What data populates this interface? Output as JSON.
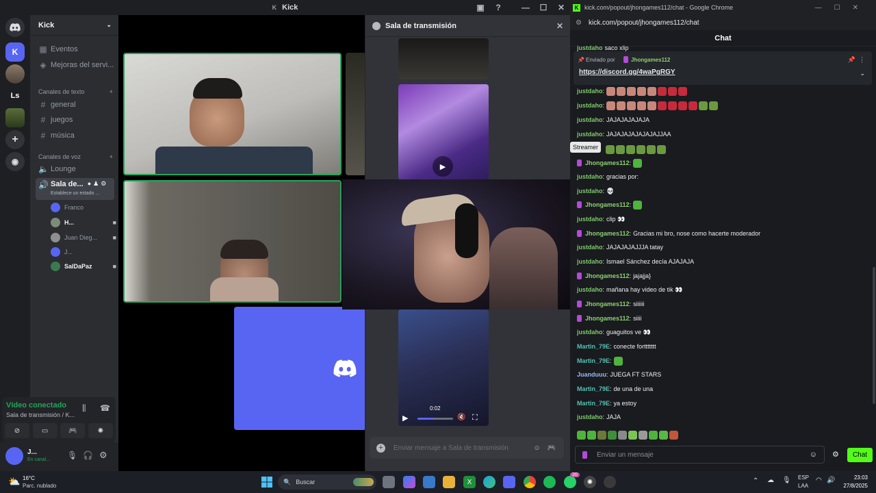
{
  "discord": {
    "window_title": "Kick",
    "server_rail": {
      "letter_server": "Ls"
    },
    "guild_name": "Kick",
    "nav": [
      {
        "label": "Eventos"
      },
      {
        "label": "Mejoras del servi..."
      }
    ],
    "text_category": "Canales de texto",
    "text_channels": [
      "general",
      "juegos",
      "música"
    ],
    "voice_category": "Canales de voz",
    "voice_channels": [
      {
        "label": "Lounge"
      },
      {
        "label": "Sala de...",
        "status": "Establece un estado ..."
      }
    ],
    "voice_users": [
      "Franco",
      "H...",
      "Juan Dieg...",
      "J...",
      "SalDaPaz"
    ],
    "voice_panel": {
      "status": "Vídeo conectado",
      "location": "Sala de transmisión / K..."
    },
    "user_panel": {
      "name": "J...",
      "status": "En canal..."
    },
    "thread": {
      "title": "Sala de transmisión",
      "video_time": "0:02",
      "input_placeholder": "Enviar mensaje a Sala de transmisión"
    }
  },
  "chrome": {
    "window_title": "kick.com/popout/jhongames112/chat - Google Chrome",
    "url": "kick.com/popout/jhongames112/chat",
    "chat_title": "Chat",
    "pinned": {
      "sent_by_label": "Enviado por",
      "sender": "Jhongames112",
      "link": "https://discord.gg/4waPgRGY"
    },
    "tooltip": "Streamer",
    "messages": [
      {
        "user": "justdaho",
        "text": "saco xlip",
        "color": "#7ec86a"
      },
      {
        "user": "justdaho",
        "text": "",
        "color": "#7ec86a",
        "emotes": 8
      },
      {
        "user": "justdaho",
        "text": "",
        "color": "#7ec86a",
        "emotes": 11
      },
      {
        "user": "justdaho",
        "text": "JAJAJAJAJAJA",
        "color": "#7ec86a"
      },
      {
        "user": "justdaho",
        "text": "JAJAJAJAJAJAJAJJAA",
        "color": "#7ec86a"
      },
      {
        "user": "",
        "text": "",
        "color": "#7ec86a",
        "emotes": 6
      },
      {
        "user": "Jhongames112",
        "text": "",
        "color": "#8ecf72",
        "emotes": 1,
        "badge": true
      },
      {
        "user": "justdaho",
        "text": "gracias por:",
        "color": "#7ec86a"
      },
      {
        "user": "justdaho",
        "text": "💀",
        "color": "#7ec86a"
      },
      {
        "user": "Jhongames112",
        "text": "",
        "color": "#8ecf72",
        "emotes": 1,
        "badge": true
      },
      {
        "user": "justdaho",
        "text": "clip 👀",
        "color": "#7ec86a"
      },
      {
        "user": "Jhongames112",
        "text": "Gracias mi bro, nose como hacerte moderador",
        "color": "#8ecf72",
        "badge": true
      },
      {
        "user": "justdaho",
        "text": "JAJAJAJAJJJA tatay",
        "color": "#7ec86a"
      },
      {
        "user": "justdaho",
        "text": "Ismael Sánchez decía AJAJAJA",
        "color": "#7ec86a"
      },
      {
        "user": "Jhongames112",
        "text": "jajajja}",
        "color": "#8ecf72",
        "badge": true
      },
      {
        "user": "justdaho",
        "text": "mañana hay video de tik 👀",
        "color": "#7ec86a"
      },
      {
        "user": "Jhongames112",
        "text": "siiiiii",
        "color": "#8ecf72",
        "badge": true
      },
      {
        "user": "Jhongames112",
        "text": "siiii",
        "color": "#8ecf72",
        "badge": true
      },
      {
        "user": "justdaho",
        "text": "guaguitos ve 👀",
        "color": "#7ec86a"
      },
      {
        "user": "Martin_79E",
        "text": "conecte forttttttt",
        "color": "#53c2b5"
      },
      {
        "user": "Martin_79E",
        "text": "",
        "color": "#53c2b5",
        "emotes": 1
      },
      {
        "user": "Juanduuu",
        "text": "JUEGA FT STARS",
        "color": "#9bb6f0"
      },
      {
        "user": "Martin_79E",
        "text": "de una de una",
        "color": "#53c2b5"
      },
      {
        "user": "Martin_79E",
        "text": "ya estoy",
        "color": "#53c2b5"
      },
      {
        "user": "justdaho",
        "text": "JAJA",
        "color": "#7ec86a"
      }
    ],
    "input_placeholder": "Enviar un mensaje",
    "chat_button": "Chat"
  },
  "taskbar": {
    "weather_temp": "16°C",
    "weather_desc": "Parc. nublado",
    "search_placeholder": "Buscar",
    "lang_top": "ESP",
    "lang_bottom": "LAA",
    "time": "23:03",
    "date": "27/8/2025",
    "whatsapp_badge": "20"
  },
  "colors": {
    "kick_green": "#53fc18",
    "discord_blurple": "#5865f2"
  }
}
